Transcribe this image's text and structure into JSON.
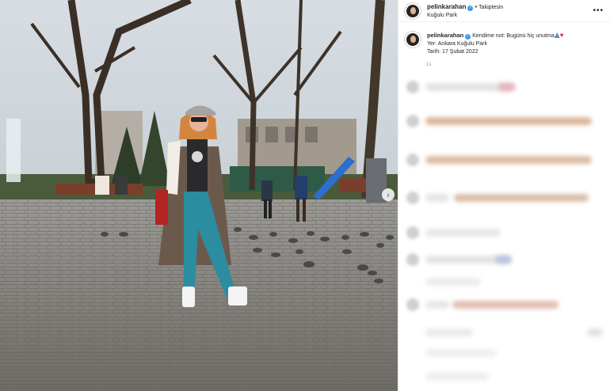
{
  "post": {
    "username": "pelinkarahan",
    "follow_state": "Takiptesin",
    "location": "Kuğulu Park",
    "caption": {
      "username": "pelinkarahan",
      "line1": "Kendime not: Bugünü hiç unutma",
      "line2": "Yer: Ankara Kuğulu Park",
      "line3": "Tarih: 17 Şubat 2022"
    },
    "time_ago": "1s"
  },
  "icons": {
    "verified": "verified-badge-icon",
    "more": "more-options-icon",
    "heart": "red-heart-emoji",
    "next": "chevron-right-icon"
  },
  "colors": {
    "verified": "#3897f0",
    "heart": "#e0245e",
    "blur_tan": "#d9b79a",
    "blur_pink": "#e7b3bc"
  }
}
